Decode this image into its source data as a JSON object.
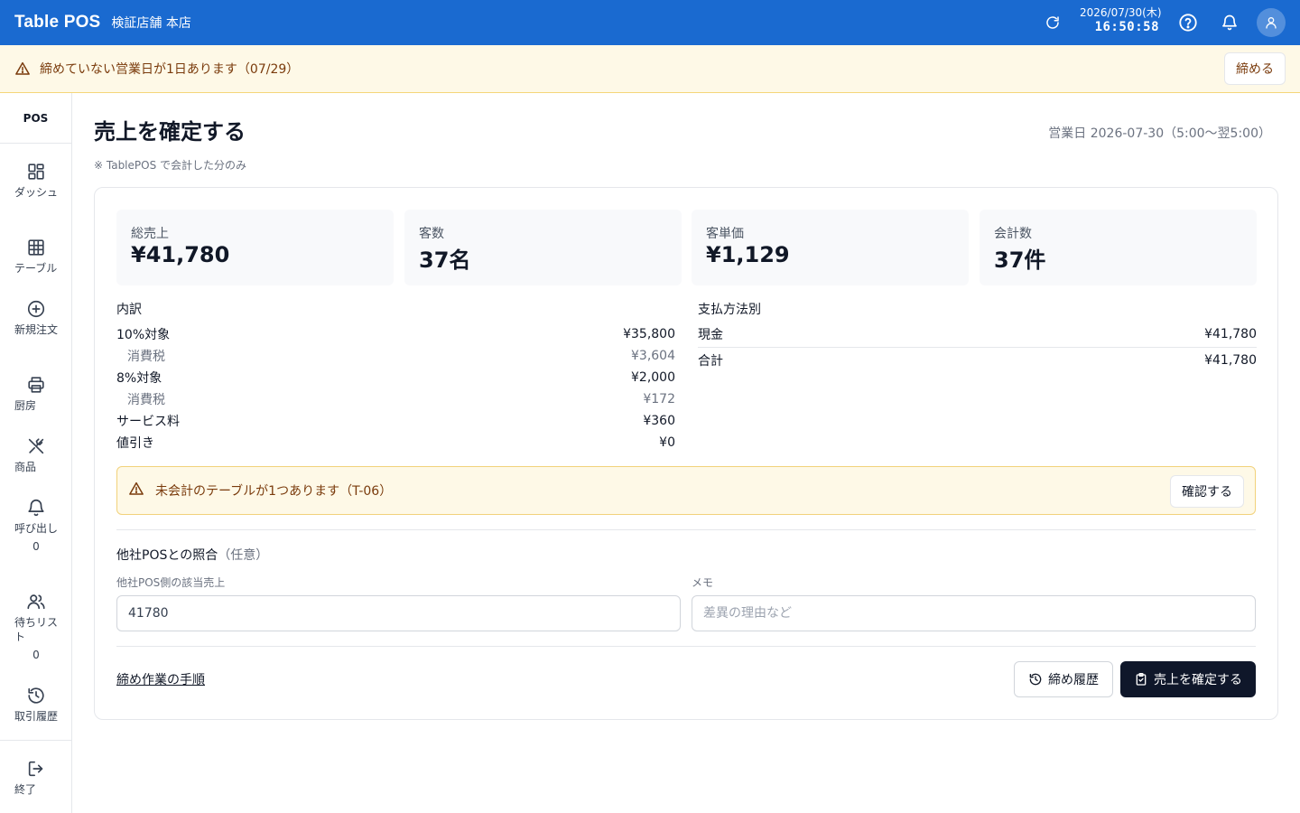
{
  "header": {
    "brand": "Table POS",
    "store": "検証店舗 本店",
    "date": "2026/07/30(木)",
    "time": "16:50:58"
  },
  "banner": {
    "text": "締めていない営業日が1日あります（07/29）",
    "button": "締める"
  },
  "sidebar": {
    "title": "POS",
    "items": [
      {
        "label": "ダッシュ",
        "icon": "dashboard-icon"
      },
      {
        "label": "テーブル",
        "icon": "table-grid-icon"
      },
      {
        "label": "新規注文",
        "icon": "plus-circle-icon"
      },
      {
        "label": "厨房",
        "icon": "printer-icon"
      },
      {
        "label": "商品",
        "icon": "utensils-icon"
      },
      {
        "label": "呼び出し",
        "icon": "bell-icon",
        "count": "0"
      },
      {
        "label": "待ちリスト",
        "icon": "users-icon",
        "count": "0"
      },
      {
        "label": "取引履歴",
        "icon": "history-icon"
      },
      {
        "label": "終了",
        "icon": "logout-icon"
      }
    ]
  },
  "page": {
    "title": "売上を確定する",
    "note": "※ TablePOS で会計した分のみ",
    "business_day": "営業日 2026-07-30（5:00〜翌5:00）"
  },
  "stats": [
    {
      "label": "総売上",
      "value": "¥41,780"
    },
    {
      "label": "客数",
      "value": "37名"
    },
    {
      "label": "客単価",
      "value": "¥1,129"
    },
    {
      "label": "会計数",
      "value": "37件"
    }
  ],
  "breakdown": {
    "title": "内訳",
    "rows": [
      {
        "label": "10%対象",
        "value": "¥35,800",
        "sub": false
      },
      {
        "label": "消費税",
        "value": "¥3,604",
        "sub": true
      },
      {
        "label": "8%対象",
        "value": "¥2,000",
        "sub": false
      },
      {
        "label": "消費税",
        "value": "¥172",
        "sub": true
      },
      {
        "label": "サービス料",
        "value": "¥360",
        "sub": false
      },
      {
        "label": "値引き",
        "value": "¥0",
        "sub": false
      }
    ]
  },
  "payment": {
    "title": "支払方法別",
    "rows": [
      {
        "label": "現金",
        "value": "¥41,780"
      },
      {
        "label": "合計",
        "value": "¥41,780"
      }
    ]
  },
  "alert": {
    "text": "未会計のテーブルが1つあります（T-06）",
    "button": "確認する"
  },
  "reconcile": {
    "title": "他社POSとの照合",
    "optional": "（任意）",
    "sales_label": "他社POS側の該当売上",
    "sales_value": "41780",
    "memo_label": "メモ",
    "memo_placeholder": "差異の理由など"
  },
  "footer": {
    "link": "締め作業の手順",
    "history_button": "締め履歴",
    "confirm_button": "売上を確定する"
  },
  "colors": {
    "header_bg": "#1a6ad0",
    "banner_bg": "#fef9e7",
    "warning_text": "#7a3b0c",
    "primary_button": "#0f172a"
  }
}
